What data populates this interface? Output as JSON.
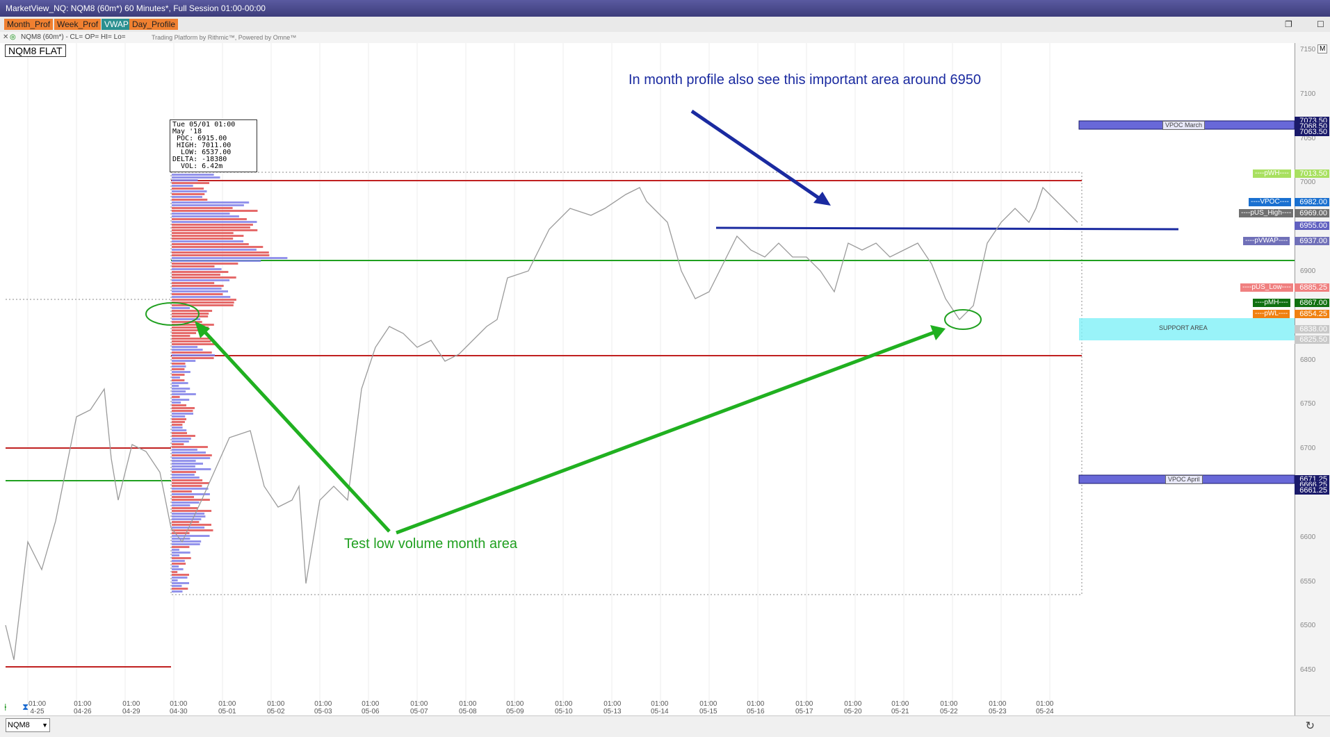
{
  "window": {
    "title": "MarketView_NQ: NQM8 (60m*) 60 Minutes*, Full Session 01:00-00:00",
    "buttons": [
      "▫",
      "▭",
      "×"
    ]
  },
  "toolbar": {
    "buttons": [
      {
        "label": "Month_Prof",
        "color": "#f08030"
      },
      {
        "label": "Week_Prof",
        "color": "#f08030"
      },
      {
        "label": "VWAP",
        "color": "#2a9090"
      },
      {
        "label": "Day_Profile",
        "color": "#f08030"
      }
    ],
    "restore_icon": "❐",
    "maximize_icon": "☐"
  },
  "infobar": {
    "text": "NQM8 (60m*) - CL= OP= HI= Lo=",
    "sub": "Trading Platform by Rithmic™, Powered by Omne™"
  },
  "chart": {
    "symbol_status": "NQM8 FLAT",
    "info_box": "Tue 05/01 01:00\nMay '18\n POC: 6915.00\n HIGH: 7011.00\n  LOW: 6537.00\nDELTA: -18380\n  VOL: 6.42m",
    "annotation_top": "In month profile also see this important area around 6950",
    "annotation_bottom": "Test low volume month area",
    "price_ticks": [
      "7150",
      "7100",
      "7050",
      "7000",
      "6950",
      "6900",
      "6850",
      "6800",
      "6750",
      "6700",
      "6650",
      "6600",
      "6550",
      "6500",
      "6450"
    ],
    "right_labels": [
      {
        "text": "7073.50",
        "bg": "#1a1a6a",
        "fg": "#ffffff"
      },
      {
        "text": "7068.50",
        "bg": "#1a1a6a",
        "fg": "#ffffff"
      },
      {
        "text": "7063.50",
        "bg": "#1a1a6a",
        "fg": "#ffffff"
      },
      {
        "text": "7013.50",
        "bg": "#a8e060",
        "fg": "#ffffff"
      },
      {
        "text": "6982.00",
        "bg": "#1a70d0",
        "fg": "#ffffff"
      },
      {
        "text": "6969.00",
        "bg": "#707070",
        "fg": "#ffffff"
      },
      {
        "text": "6955.00",
        "bg": "#6060c0",
        "fg": "#ffffff"
      },
      {
        "text": "6937.00",
        "bg": "#7070b8",
        "fg": "#ffffff"
      },
      {
        "text": "6885.25",
        "bg": "#f08080",
        "fg": "#ffffff"
      },
      {
        "text": "6867.00",
        "bg": "#107010",
        "fg": "#ffffff"
      },
      {
        "text": "6854.25",
        "bg": "#f08010",
        "fg": "#ffffff"
      },
      {
        "text": "6838.00",
        "bg": "#c8c8c8",
        "fg": "#ffffff"
      },
      {
        "text": "6825.50",
        "bg": "#c8c8c8",
        "fg": "#ffffff"
      },
      {
        "text": "6671.25",
        "bg": "#1a1a6a",
        "fg": "#ffffff"
      },
      {
        "text": "6666.25",
        "bg": "#1a1a6a",
        "fg": "#ffffff"
      },
      {
        "text": "6661.25",
        "bg": "#1a1a6a",
        "fg": "#ffffff"
      }
    ],
    "line_tags": [
      {
        "text": "----pWH----"
      },
      {
        "text": "----VPOC----"
      },
      {
        "text": "----pUS_High----"
      },
      {
        "text": "----pVWAP----"
      },
      {
        "text": "----pUS_Low----"
      },
      {
        "text": "----pMH----"
      },
      {
        "text": "----pWL----"
      }
    ],
    "zone_labels": {
      "vpoc_march": "VPOC March",
      "vpoc_april": "VPOC April",
      "support": "SUPPORT AREA"
    },
    "x_ticks": [
      {
        "t": "01:00",
        "d": "4-25"
      },
      {
        "t": "01:00",
        "d": "04-26"
      },
      {
        "t": "01:00",
        "d": "04-29"
      },
      {
        "t": "01:00",
        "d": "04-30"
      },
      {
        "t": "01:00",
        "d": "05-01"
      },
      {
        "t": "01:00",
        "d": "05-02"
      },
      {
        "t": "01:00",
        "d": "05-03"
      },
      {
        "t": "01:00",
        "d": "05-06"
      },
      {
        "t": "01:00",
        "d": "05-07"
      },
      {
        "t": "01:00",
        "d": "05-08"
      },
      {
        "t": "01:00",
        "d": "05-09"
      },
      {
        "t": "01:00",
        "d": "05-10"
      },
      {
        "t": "01:00",
        "d": "05-13"
      },
      {
        "t": "01:00",
        "d": "05-14"
      },
      {
        "t": "01:00",
        "d": "05-15"
      },
      {
        "t": "01:00",
        "d": "05-16"
      },
      {
        "t": "01:00",
        "d": "05-17"
      },
      {
        "t": "01:00",
        "d": "05-20"
      },
      {
        "t": "01:00",
        "d": "05-21"
      },
      {
        "t": "01:00",
        "d": "05-22"
      },
      {
        "t": "01:00",
        "d": "05-23"
      },
      {
        "t": "01:00",
        "d": "05-24"
      }
    ],
    "x_ticks2": [
      "01:00",
      "01:00",
      "01:00",
      "01:00",
      "01:00",
      "01:00",
      "01:00",
      "01:00",
      "01:00",
      "01:00",
      "01:00",
      "01:00",
      "01:00",
      "01:00",
      "01:00",
      "01:00",
      "01:00",
      "01:00",
      "01:00",
      "01:00",
      "01:00"
    ],
    "scale_marker": "M"
  },
  "bottom": {
    "symbol_select": "NQM8"
  }
}
